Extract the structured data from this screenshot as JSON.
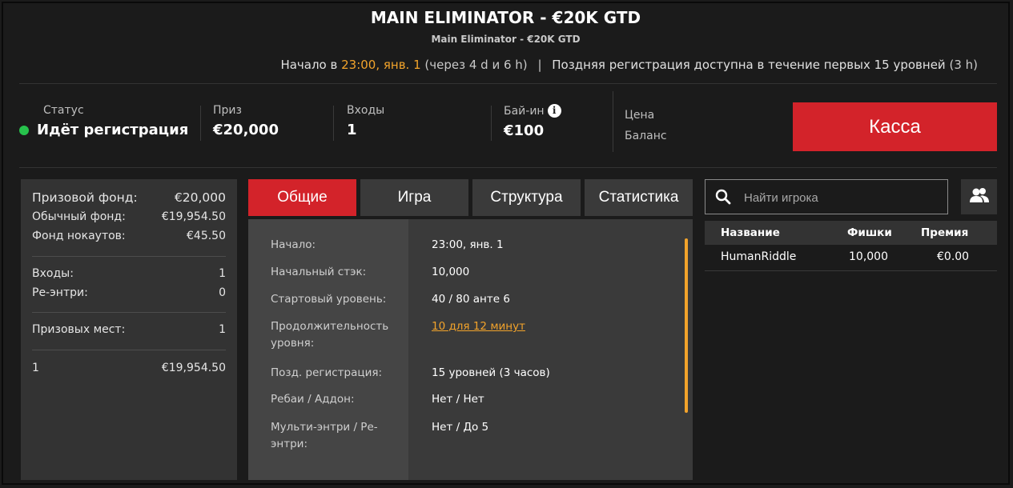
{
  "header": {
    "title": "MAIN ELIMINATOR - €20K GTD",
    "subtitle": "Main Eliminator - €20K GTD",
    "start_prefix": "Начало в",
    "start_time": "23:00, янв. 1",
    "start_countdown": "(через 4 d и 6 h)",
    "separator": "|",
    "late_reg_text": "Поздняя регистрация доступна в течение первых 15 уровней",
    "late_reg_duration": "(3 h)"
  },
  "stats": {
    "status_label": "Статус",
    "status_value": "Идёт регистрация",
    "prize_label": "Приз",
    "prize_value": "€20,000",
    "entries_label": "Входы",
    "entries_value": "1",
    "buyin_label": "Бай-ин",
    "buyin_value": "€100",
    "price_label": "Цена",
    "balance_label": "Баланс",
    "cashier_label": "Касса"
  },
  "prize_panel": {
    "prize_pool_label": "Призовой фонд:",
    "prize_pool_value": "€20,000",
    "regular_pool_label": "Обычный фонд:",
    "regular_pool_value": "€19,954.50",
    "bounty_pool_label": "Фонд нокаутов:",
    "bounty_pool_value": "€45.50",
    "entries_label": "Входы:",
    "entries_value": "1",
    "reentries_label": "Ре-энтри:",
    "reentries_value": "0",
    "places_label": "Призовых мест:",
    "places_value": "1",
    "payouts": [
      {
        "place": "1",
        "amount": "€19,954.50"
      }
    ]
  },
  "tabs": [
    {
      "label": "Общие",
      "active": true
    },
    {
      "label": "Игра",
      "active": false
    },
    {
      "label": "Структура",
      "active": false
    },
    {
      "label": "Статистика",
      "active": false
    }
  ],
  "info": {
    "rows": [
      {
        "label": "Начало:",
        "value": "23:00, янв. 1"
      },
      {
        "label": "Начальный стэк:",
        "value": "10,000"
      },
      {
        "label": "Стартовый уровень:",
        "value": "40 / 80 анте 6"
      },
      {
        "label": "Продолжительность уровня:",
        "value": "10 для 12 минут"
      },
      {
        "label": "Позд. регистрация:",
        "value": "15 уровней (3 часов)"
      },
      {
        "label": "Ребаи / Аддон:",
        "value": "Нет / Нет"
      },
      {
        "label": "Мульти-энтри / Ре-энтри:",
        "value": "Нет / До 5"
      }
    ]
  },
  "players": {
    "search_placeholder": "Найти игрока",
    "columns": [
      "Название",
      "Фишки",
      "Премия"
    ],
    "rows": [
      {
        "name": "HumanRiddle",
        "chips": "10,000",
        "prize": "€0.00"
      }
    ]
  },
  "colors": {
    "accent_red": "#d3232a",
    "accent_orange": "#f2a32b",
    "status_green": "#27c24c"
  }
}
